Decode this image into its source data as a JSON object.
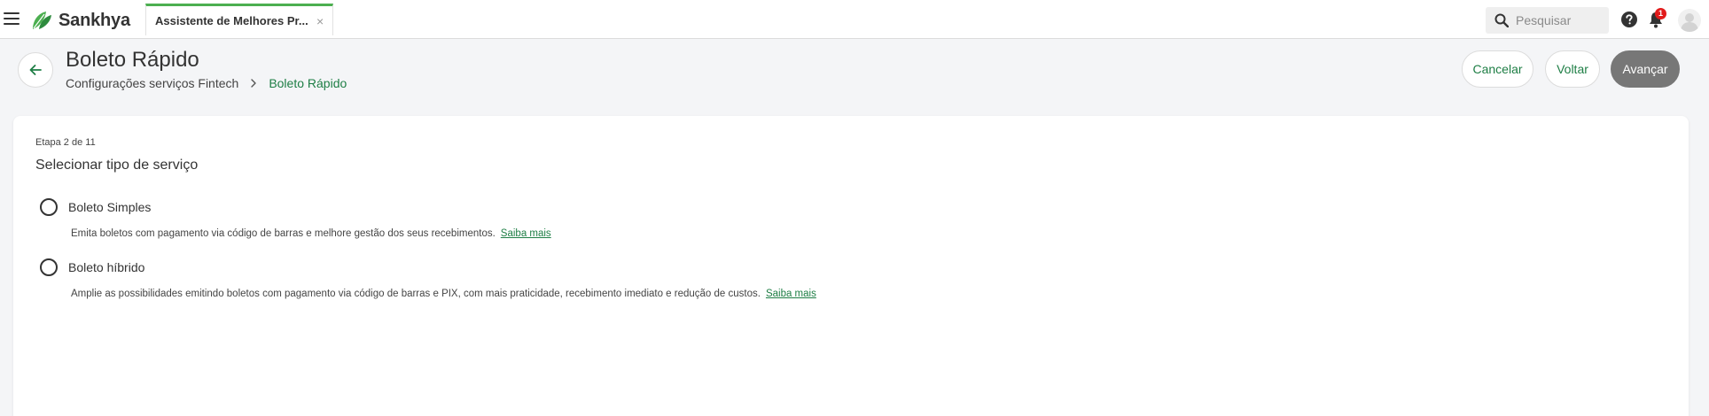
{
  "app": {
    "brand": "Sankhya"
  },
  "tab": {
    "label": "Assistente de Melhores Pr...",
    "close": "×"
  },
  "search": {
    "placeholder": "Pesquisar"
  },
  "notifications": {
    "count": "1"
  },
  "header": {
    "title": "Boleto Rápido",
    "breadcrumb": [
      "Configurações serviços Fintech",
      "Boleto Rápido"
    ]
  },
  "actions": {
    "cancel": "Cancelar",
    "back": "Voltar",
    "next": "Avançar"
  },
  "wizard": {
    "step": "Etapa 2 de 11",
    "section_title": "Selecionar tipo de serviço",
    "options": [
      {
        "label": "Boleto Simples",
        "description": "Emita boletos com pagamento via código de barras e melhore gestão dos seus recebimentos.",
        "link": "Saiba mais"
      },
      {
        "label": "Boleto híbrido",
        "description": "Amplie as possibilidades emitindo boletos com pagamento via código de barras e PIX, com mais praticidade, recebimento imediato e redução de custos.",
        "link": "Saiba mais"
      }
    ]
  },
  "colors": {
    "accent": "#1e7e45",
    "tab_indicator": "#4caf50",
    "primary_disabled": "#777777",
    "badge": "#e21b1b"
  }
}
